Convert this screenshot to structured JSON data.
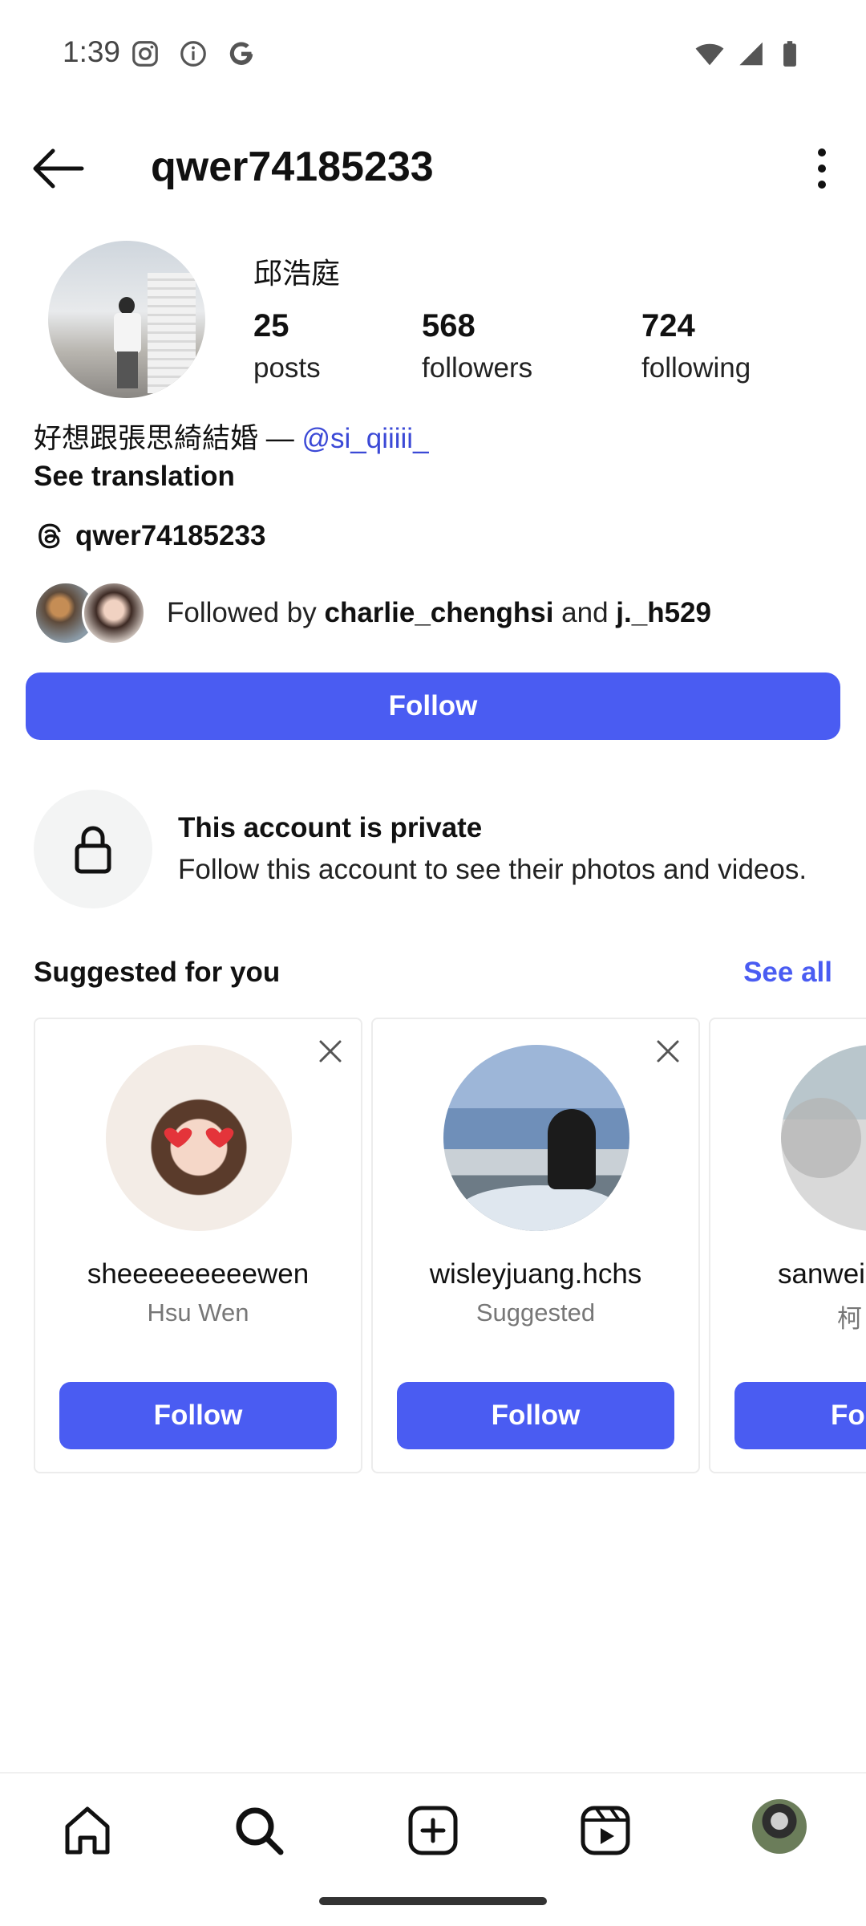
{
  "status_bar": {
    "time": "1:39"
  },
  "header": {
    "username": "qwer74185233"
  },
  "profile": {
    "full_name": "邱浩庭",
    "stats": [
      {
        "value": "25",
        "label": "posts"
      },
      {
        "value": "568",
        "label": "followers"
      },
      {
        "value": "724",
        "label": "following"
      }
    ],
    "bio_text": "好想跟張思綺結婚 — ",
    "bio_mention": "@si_qiiiii_",
    "see_translation": "See translation",
    "threads_handle": "qwer74185233",
    "followed_by_prefix": "Followed by ",
    "followed_by_user1": "charlie_chenghsi",
    "followed_by_and": " and ",
    "followed_by_user2": "j._h529",
    "follow_label": "Follow"
  },
  "private_notice": {
    "title": "This account is private",
    "subtitle": "Follow this account to see their photos and videos."
  },
  "suggestions": {
    "title": "Suggested for you",
    "see_all": "See all",
    "cards": [
      {
        "username": "sheeeeeeeeewen",
        "subtitle": "Hsu Wen",
        "follow_label": "Follow"
      },
      {
        "username": "wisleyjuang.hchs",
        "subtitle": "Suggested",
        "follow_label": "Follow"
      },
      {
        "username": "sanwei",
        "subtitle": "柯",
        "follow_label": "Fo"
      }
    ]
  },
  "colors": {
    "accent": "#4a5cf2",
    "mention": "#3b49d6"
  },
  "bottom_nav": [
    "home-icon",
    "search-icon",
    "create-icon",
    "reels-icon",
    "profile-avatar"
  ]
}
